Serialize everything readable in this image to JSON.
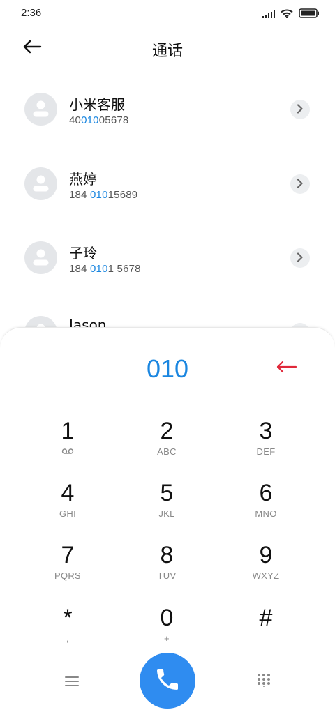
{
  "status_bar": {
    "time": "2:36",
    "icons": [
      "signal-icon",
      "wifi-icon",
      "battery-icon"
    ]
  },
  "header": {
    "title": "通话",
    "back_icon": "back-arrow-icon"
  },
  "contacts": [
    {
      "name": "小米客服",
      "number_pre": "40",
      "number_match": "010",
      "number_post": "05678"
    },
    {
      "name": "燕婷",
      "number_pre": "184 ",
      "number_match": "010",
      "number_post": "15689"
    },
    {
      "name": "子玲",
      "number_pre": "184 ",
      "number_match": "010",
      "number_post": "1 5678"
    },
    {
      "name": "Jason",
      "number_pre": "",
      "number_match": "",
      "number_post": ""
    }
  ],
  "dialpad": {
    "entered_number": "010",
    "keys": [
      {
        "digit": "1",
        "sub": "voicemail"
      },
      {
        "digit": "2",
        "sub": "ABC"
      },
      {
        "digit": "3",
        "sub": "DEF"
      },
      {
        "digit": "4",
        "sub": "GHI"
      },
      {
        "digit": "5",
        "sub": "JKL"
      },
      {
        "digit": "6",
        "sub": "MNO"
      },
      {
        "digit": "7",
        "sub": "PQRS"
      },
      {
        "digit": "8",
        "sub": "TUV"
      },
      {
        "digit": "9",
        "sub": "WXYZ"
      },
      {
        "digit": "*",
        "sub": ","
      },
      {
        "digit": "0",
        "sub": "+"
      },
      {
        "digit": "#",
        "sub": ""
      }
    ]
  },
  "colors": {
    "accent": "#1a86e0",
    "call_button": "#2f8cf0",
    "delete": "#e0283a"
  }
}
